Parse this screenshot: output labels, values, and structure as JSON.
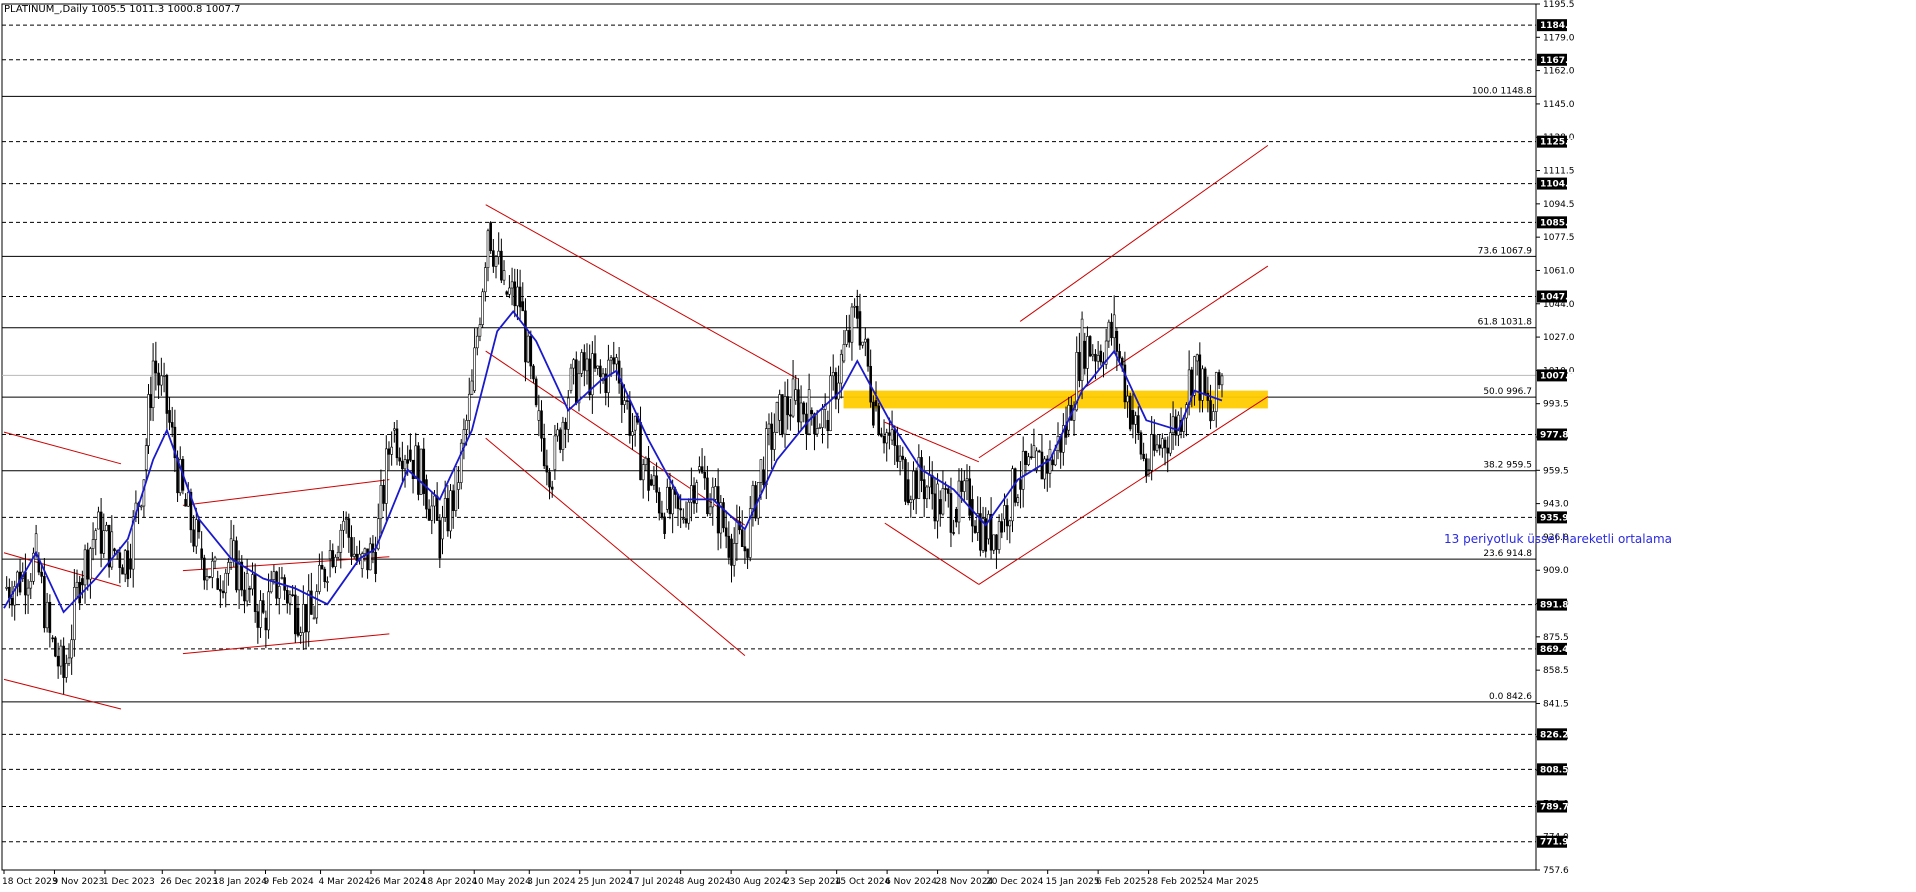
{
  "header": {
    "symbol_label": "PLATINUM_,Daily  1005.5 1011.3 1000.8 1007.7"
  },
  "annotation": {
    "ema_text": "13 periyotluk üssel hareketli ortalama"
  },
  "colors": {
    "background": "#ffffff",
    "candles": "#000000",
    "ema": "#1a1acc",
    "trendline": "#cc0000",
    "zone": "#ffcc00",
    "price_tag_bg": "#000000",
    "price_tag_fg": "#ffffff"
  },
  "chart_data": {
    "type": "candlestick",
    "title": "PLATINUM_,Daily",
    "ohlc_last": {
      "open": 1005.5,
      "high": 1011.3,
      "low": 1000.8,
      "close": 1007.7
    },
    "ylim": [
      757.6,
      1195.5
    ],
    "x_range": [
      "2023-10-18",
      "2025-04-01"
    ],
    "y_tick_labels": [
      "1195.5",
      "1179.0",
      "1162.0",
      "1145.0",
      "1128.0",
      "1111.5",
      "1094.5",
      "1077.5",
      "1061.0",
      "1044.0",
      "1027.0",
      "1010.0",
      "993.5",
      "976.5",
      "959.5",
      "943.0",
      "926.0",
      "909.0",
      "892.0",
      "875.5",
      "858.5",
      "841.5",
      "824.5",
      "808.0",
      "791.0",
      "774.0",
      "757.6"
    ],
    "x_tick_labels": [
      {
        "label": "18 Oct 2023",
        "date": "2023-10-18"
      },
      {
        "label": "9 Nov 2023",
        "date": "2023-11-09"
      },
      {
        "label": "1 Dec 2023",
        "date": "2023-12-01"
      },
      {
        "label": "26 Dec 2023",
        "date": "2023-12-26"
      },
      {
        "label": "18 Jan 2024",
        "date": "2024-01-18"
      },
      {
        "label": "9 Feb 2024",
        "date": "2024-02-09"
      },
      {
        "label": "4 Mar 2024",
        "date": "2024-03-04"
      },
      {
        "label": "26 Mar 2024",
        "date": "2024-03-26"
      },
      {
        "label": "18 Apr 2024",
        "date": "2024-04-18"
      },
      {
        "label": "10 May 2024",
        "date": "2024-05-10"
      },
      {
        "label": "3 Jun 2024",
        "date": "2024-06-03"
      },
      {
        "label": "25 Jun 2024",
        "date": "2024-06-25"
      },
      {
        "label": "17 Jul 2024",
        "date": "2024-07-17"
      },
      {
        "label": "8 Aug 2024",
        "date": "2024-08-08"
      },
      {
        "label": "30 Aug 2024",
        "date": "2024-08-30"
      },
      {
        "label": "23 Sep 2024",
        "date": "2024-09-23"
      },
      {
        "label": "15 Oct 2024",
        "date": "2024-10-15"
      },
      {
        "label": "6 Nov 2024",
        "date": "2024-11-06"
      },
      {
        "label": "28 Nov 2024",
        "date": "2024-11-28"
      },
      {
        "label": "20 Dec 2024",
        "date": "2024-12-20"
      },
      {
        "label": "15 Jan 2025",
        "date": "2025-01-15"
      },
      {
        "label": "6 Feb 2025",
        "date": "2025-02-06"
      },
      {
        "label": "28 Feb 2025",
        "date": "2025-02-28"
      },
      {
        "label": "24 Mar 2025",
        "date": "2025-03-24"
      }
    ],
    "horizontal_levels": [
      {
        "price": 1184.8,
        "style": "dashed",
        "tag": "1184.8"
      },
      {
        "price": 1167.3,
        "style": "dashed",
        "tag": "1167.3"
      },
      {
        "price": 1148.8,
        "style": "solid",
        "label": "100.0 1148.8"
      },
      {
        "price": 1125.9,
        "style": "dashed",
        "tag": "1125.9"
      },
      {
        "price": 1104.7,
        "style": "dashed",
        "tag": "1104.7"
      },
      {
        "price": 1085.1,
        "style": "dashed",
        "tag": "1085.1"
      },
      {
        "price": 1067.9,
        "style": "solid",
        "label": "73.6 1067.9"
      },
      {
        "price": 1047.6,
        "style": "dashed",
        "tag": "1047.6"
      },
      {
        "price": 1031.8,
        "style": "solid",
        "label": "61.8 1031.8"
      },
      {
        "price": 1007.7,
        "style": "current",
        "tag": "1007.7"
      },
      {
        "price": 996.7,
        "style": "solid",
        "label": "50.0 996.7"
      },
      {
        "price": 977.8,
        "style": "dashed",
        "tag": "977.8"
      },
      {
        "price": 959.5,
        "style": "solid",
        "label": "38.2 959.5"
      },
      {
        "price": 935.9,
        "style": "dashed",
        "tag": "935.9"
      },
      {
        "price": 914.8,
        "style": "solid",
        "label": "23.6 914.8"
      },
      {
        "price": 891.8,
        "style": "dashed",
        "tag": "891.8"
      },
      {
        "price": 869.4,
        "style": "dashed",
        "tag": "869.4"
      },
      {
        "price": 842.6,
        "style": "solid",
        "label": "0.0 842.6"
      },
      {
        "price": 826.2,
        "style": "dashed",
        "tag": "826.2"
      },
      {
        "price": 808.5,
        "style": "dashed",
        "tag": "808.5"
      },
      {
        "price": 789.7,
        "style": "dashed",
        "tag": "789.7"
      },
      {
        "price": 771.9,
        "style": "dashed",
        "tag": "771.9"
      }
    ],
    "zone": {
      "from": "2024-10-18",
      "to": "2025-04-21",
      "low": 991,
      "high": 1000
    },
    "trendlines": [
      {
        "from": {
          "date": "2023-10-18",
          "price": 979
        },
        "to": {
          "date": "2023-12-08",
          "price": 963
        }
      },
      {
        "from": {
          "date": "2023-10-18",
          "price": 918
        },
        "to": {
          "date": "2023-12-08",
          "price": 901
        }
      },
      {
        "from": {
          "date": "2023-10-18",
          "price": 854
        },
        "to": {
          "date": "2023-12-08",
          "price": 839
        }
      },
      {
        "from": {
          "date": "2024-01-04",
          "price": 942
        },
        "to": {
          "date": "2024-04-03",
          "price": 955
        }
      },
      {
        "from": {
          "date": "2024-01-04",
          "price": 909
        },
        "to": {
          "date": "2024-04-03",
          "price": 916
        }
      },
      {
        "from": {
          "date": "2024-01-04",
          "price": 867
        },
        "to": {
          "date": "2024-04-03",
          "price": 877
        }
      },
      {
        "from": {
          "date": "2024-05-15",
          "price": 1094
        },
        "to": {
          "date": "2024-09-28",
          "price": 1006
        }
      },
      {
        "from": {
          "date": "2024-05-15",
          "price": 1020
        },
        "to": {
          "date": "2024-09-05",
          "price": 932
        }
      },
      {
        "from": {
          "date": "2024-05-15",
          "price": 976
        },
        "to": {
          "date": "2024-09-05",
          "price": 866
        }
      },
      {
        "from": {
          "date": "2024-11-05",
          "price": 984
        },
        "to": {
          "date": "2024-12-16",
          "price": 964
        }
      },
      {
        "from": {
          "date": "2024-11-05",
          "price": 933
        },
        "to": {
          "date": "2024-12-16",
          "price": 902
        }
      },
      {
        "from": {
          "date": "2024-12-16",
          "price": 902
        },
        "to": {
          "date": "2025-04-21",
          "price": 997
        }
      },
      {
        "from": {
          "date": "2024-12-16",
          "price": 966
        },
        "to": {
          "date": "2025-04-21",
          "price": 1063
        }
      },
      {
        "from": {
          "date": "2025-01-03",
          "price": 1035
        },
        "to": {
          "date": "2025-04-21",
          "price": 1124
        }
      }
    ],
    "ema_period": 13,
    "series": [
      {
        "name": "Close",
        "values": [
          {
            "date": "2023-10-18",
            "close": 900
          },
          {
            "date": "2023-10-25",
            "close": 905
          },
          {
            "date": "2023-11-01",
            "close": 915
          },
          {
            "date": "2023-11-07",
            "close": 875
          },
          {
            "date": "2023-11-13",
            "close": 855
          },
          {
            "date": "2023-11-20",
            "close": 905
          },
          {
            "date": "2023-11-27",
            "close": 930
          },
          {
            "date": "2023-12-04",
            "close": 920
          },
          {
            "date": "2023-12-11",
            "close": 915
          },
          {
            "date": "2023-12-18",
            "close": 960
          },
          {
            "date": "2023-12-22",
            "close": 1015
          },
          {
            "date": "2023-12-28",
            "close": 990
          },
          {
            "date": "2024-01-04",
            "close": 945
          },
          {
            "date": "2024-01-11",
            "close": 920
          },
          {
            "date": "2024-01-18",
            "close": 905
          },
          {
            "date": "2024-01-25",
            "close": 915
          },
          {
            "date": "2024-02-01",
            "close": 900
          },
          {
            "date": "2024-02-08",
            "close": 885
          },
          {
            "date": "2024-02-15",
            "close": 905
          },
          {
            "date": "2024-02-22",
            "close": 890
          },
          {
            "date": "2024-02-29",
            "close": 885
          },
          {
            "date": "2024-03-07",
            "close": 915
          },
          {
            "date": "2024-03-14",
            "close": 935
          },
          {
            "date": "2024-03-21",
            "close": 910
          },
          {
            "date": "2024-03-28",
            "close": 920
          },
          {
            "date": "2024-04-04",
            "close": 980
          },
          {
            "date": "2024-04-11",
            "close": 970
          },
          {
            "date": "2024-04-18",
            "close": 955
          },
          {
            "date": "2024-04-25",
            "close": 925
          },
          {
            "date": "2024-05-02",
            "close": 950
          },
          {
            "date": "2024-05-09",
            "close": 1000
          },
          {
            "date": "2024-05-16",
            "close": 1085
          },
          {
            "date": "2024-05-23",
            "close": 1050
          },
          {
            "date": "2024-05-30",
            "close": 1045
          },
          {
            "date": "2024-06-06",
            "close": 985
          },
          {
            "date": "2024-06-13",
            "close": 960
          },
          {
            "date": "2024-06-20",
            "close": 1000
          },
          {
            "date": "2024-06-27",
            "close": 1010
          },
          {
            "date": "2024-07-04",
            "close": 1005
          },
          {
            "date": "2024-07-11",
            "close": 1015
          },
          {
            "date": "2024-07-18",
            "close": 980
          },
          {
            "date": "2024-07-25",
            "close": 955
          },
          {
            "date": "2024-08-01",
            "close": 940
          },
          {
            "date": "2024-08-08",
            "close": 935
          },
          {
            "date": "2024-08-15",
            "close": 960
          },
          {
            "date": "2024-08-22",
            "close": 945
          },
          {
            "date": "2024-08-29",
            "close": 925
          },
          {
            "date": "2024-09-05",
            "close": 920
          },
          {
            "date": "2024-09-12",
            "close": 960
          },
          {
            "date": "2024-09-19",
            "close": 985
          },
          {
            "date": "2024-09-26",
            "close": 995
          },
          {
            "date": "2024-10-03",
            "close": 990
          },
          {
            "date": "2024-10-10",
            "close": 985
          },
          {
            "date": "2024-10-17",
            "close": 1015
          },
          {
            "date": "2024-10-24",
            "close": 1040
          },
          {
            "date": "2024-10-31",
            "close": 995
          },
          {
            "date": "2024-11-07",
            "close": 975
          },
          {
            "date": "2024-11-14",
            "close": 955
          },
          {
            "date": "2024-11-21",
            "close": 955
          },
          {
            "date": "2024-11-28",
            "close": 945
          },
          {
            "date": "2024-12-05",
            "close": 940
          },
          {
            "date": "2024-12-12",
            "close": 945
          },
          {
            "date": "2024-12-19",
            "close": 925
          },
          {
            "date": "2024-12-26",
            "close": 935
          },
          {
            "date": "2025-01-02",
            "close": 955
          },
          {
            "date": "2025-01-09",
            "close": 960
          },
          {
            "date": "2025-01-16",
            "close": 965
          },
          {
            "date": "2025-01-23",
            "close": 980
          },
          {
            "date": "2025-01-30",
            "close": 1025
          },
          {
            "date": "2025-02-06",
            "close": 1020
          },
          {
            "date": "2025-02-13",
            "close": 1030
          },
          {
            "date": "2025-02-20",
            "close": 990
          },
          {
            "date": "2025-02-27",
            "close": 960
          },
          {
            "date": "2025-03-06",
            "close": 975
          },
          {
            "date": "2025-03-13",
            "close": 985
          },
          {
            "date": "2025-03-20",
            "close": 1015
          },
          {
            "date": "2025-03-27",
            "close": 985
          },
          {
            "date": "2025-04-01",
            "close": 1007.7
          }
        ]
      },
      {
        "name": "EMA",
        "values": [
          {
            "date": "2023-10-18",
            "value": 890
          },
          {
            "date": "2023-11-01",
            "value": 918
          },
          {
            "date": "2023-11-13",
            "value": 888
          },
          {
            "date": "2023-11-27",
            "value": 905
          },
          {
            "date": "2023-12-11",
            "value": 925
          },
          {
            "date": "2023-12-22",
            "value": 965
          },
          {
            "date": "2023-12-28",
            "value": 980
          },
          {
            "date": "2024-01-11",
            "value": 935
          },
          {
            "date": "2024-01-25",
            "value": 915
          },
          {
            "date": "2024-02-08",
            "value": 905
          },
          {
            "date": "2024-02-22",
            "value": 900
          },
          {
            "date": "2024-03-07",
            "value": 892
          },
          {
            "date": "2024-03-21",
            "value": 915
          },
          {
            "date": "2024-03-28",
            "value": 920
          },
          {
            "date": "2024-04-11",
            "value": 960
          },
          {
            "date": "2024-04-25",
            "value": 945
          },
          {
            "date": "2024-05-09",
            "value": 980
          },
          {
            "date": "2024-05-20",
            "value": 1030
          },
          {
            "date": "2024-05-27",
            "value": 1040
          },
          {
            "date": "2024-06-06",
            "value": 1025
          },
          {
            "date": "2024-06-20",
            "value": 990
          },
          {
            "date": "2024-07-04",
            "value": 1005
          },
          {
            "date": "2024-07-11",
            "value": 1010
          },
          {
            "date": "2024-07-25",
            "value": 975
          },
          {
            "date": "2024-08-08",
            "value": 945
          },
          {
            "date": "2024-08-22",
            "value": 945
          },
          {
            "date": "2024-09-05",
            "value": 930
          },
          {
            "date": "2024-09-19",
            "value": 965
          },
          {
            "date": "2024-10-03",
            "value": 985
          },
          {
            "date": "2024-10-17",
            "value": 1000
          },
          {
            "date": "2024-10-24",
            "value": 1015
          },
          {
            "date": "2024-11-07",
            "value": 985
          },
          {
            "date": "2024-11-21",
            "value": 960
          },
          {
            "date": "2024-12-05",
            "value": 950
          },
          {
            "date": "2024-12-19",
            "value": 932
          },
          {
            "date": "2025-01-02",
            "value": 955
          },
          {
            "date": "2025-01-16",
            "value": 965
          },
          {
            "date": "2025-01-30",
            "value": 1000
          },
          {
            "date": "2025-02-13",
            "value": 1020
          },
          {
            "date": "2025-02-27",
            "value": 985
          },
          {
            "date": "2025-03-13",
            "value": 980
          },
          {
            "date": "2025-03-20",
            "value": 1000
          },
          {
            "date": "2025-04-01",
            "value": 995
          }
        ]
      }
    ]
  }
}
